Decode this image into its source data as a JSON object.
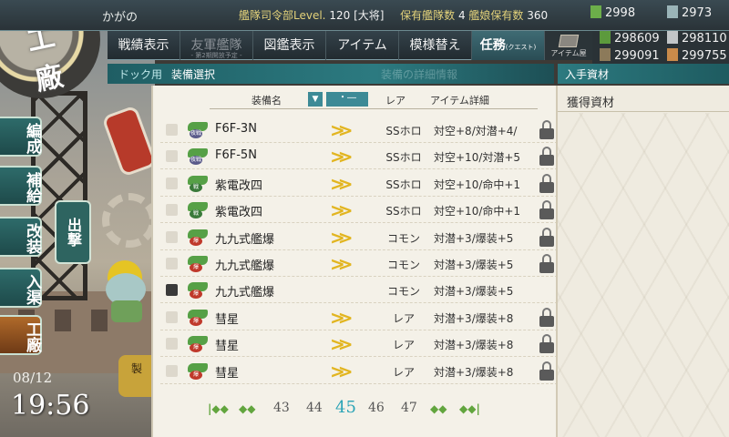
{
  "header": {
    "admiral_name": "かがの",
    "hq_label": "艦隊司令部Level.",
    "hq_level": "120",
    "rank": "[大将]",
    "ships_label": "保有艦隊数",
    "ships_value": "4",
    "girls_label": "艦娘保有数",
    "girls_value": "360",
    "bucket_count": "2998",
    "devmat_count": "2973"
  },
  "nav": {
    "items": [
      {
        "label": "戦績表示",
        "sub": ""
      },
      {
        "label": "友軍艦隊",
        "sub": "- 第2期開放予定 -"
      },
      {
        "label": "図鑑表示",
        "sub": ""
      },
      {
        "label": "アイテム",
        "sub": ""
      },
      {
        "label": "模様替え",
        "sub": ""
      }
    ],
    "quest_label": "任務",
    "quest_sub": "(クエスト)",
    "shop_label": "アイテム屋"
  },
  "resources": {
    "fuel": "298609",
    "steel": "298110",
    "ammo": "299091",
    "bauxite": "299755"
  },
  "subheader": {
    "dock_label": "ドック用",
    "select_label": "装備選択",
    "ghost_label": "装備の詳細情報",
    "acquired_header": "入手資材"
  },
  "columns": {
    "name": "装備名",
    "sort_icon": "▼",
    "sort_mode": "・―",
    "rarity": "レア",
    "detail": "アイテム詳細"
  },
  "equipment": [
    {
      "name": "F6F-3N",
      "rarity": "SSホロ",
      "detail": "対空+8/対潜+4/",
      "tag": "夜戦",
      "tag_color": "#5a5a8a",
      "checked": false,
      "lock": true
    },
    {
      "name": "F6F-5N",
      "rarity": "SSホロ",
      "detail": "対空+10/対潜+5",
      "tag": "夜戦",
      "tag_color": "#5a5a8a",
      "checked": false,
      "lock": true
    },
    {
      "name": "紫電改四",
      "rarity": "SSホロ",
      "detail": "対空+10/命中+1",
      "tag": "戦",
      "tag_color": "#3a7a3a",
      "checked": false,
      "lock": true
    },
    {
      "name": "紫電改四",
      "rarity": "SSホロ",
      "detail": "対空+10/命中+1",
      "tag": "戦",
      "tag_color": "#3a7a3a",
      "checked": false,
      "lock": true
    },
    {
      "name": "九九式艦爆",
      "rarity": "コモン",
      "detail": "対潜+3/爆装+5",
      "tag": "爆",
      "tag_color": "#c0392b",
      "checked": false,
      "lock": true
    },
    {
      "name": "九九式艦爆",
      "rarity": "コモン",
      "detail": "対潜+3/爆装+5",
      "tag": "爆",
      "tag_color": "#c0392b",
      "checked": false,
      "lock": true
    },
    {
      "name": "九九式艦爆",
      "rarity": "コモン",
      "detail": "対潜+3/爆装+5",
      "tag": "爆",
      "tag_color": "#c0392b",
      "checked": true,
      "lock": false
    },
    {
      "name": "彗星",
      "rarity": "レア",
      "detail": "対潜+3/爆装+8",
      "tag": "爆",
      "tag_color": "#c0392b",
      "checked": false,
      "lock": true
    },
    {
      "name": "彗星",
      "rarity": "レア",
      "detail": "対潜+3/爆装+8",
      "tag": "爆",
      "tag_color": "#c0392b",
      "checked": false,
      "lock": true
    },
    {
      "name": "彗星",
      "rarity": "レア",
      "detail": "対潜+3/爆装+8",
      "tag": "爆",
      "tag_color": "#c0392b",
      "checked": false,
      "lock": true
    }
  ],
  "pager": {
    "pages": [
      "43",
      "44",
      "45",
      "46",
      "47"
    ],
    "current": "45"
  },
  "acquired": {
    "title": "獲得資材"
  },
  "sidebar": {
    "emblem_text": "工廠",
    "items": [
      "編成",
      "補給",
      "改装",
      "入渠",
      "工廠"
    ],
    "sortie": "出撃"
  },
  "clock": {
    "date": "08/12",
    "time": "19:56"
  },
  "art_button": "製"
}
